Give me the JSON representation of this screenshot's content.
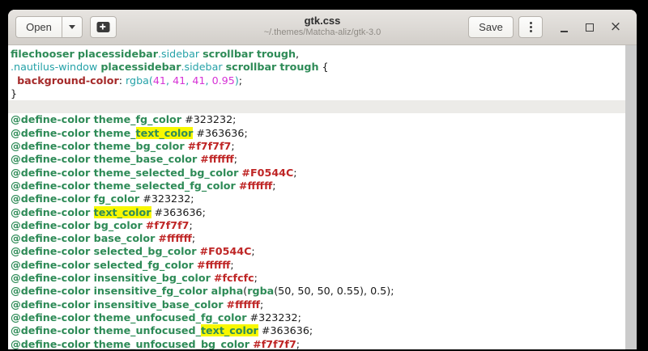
{
  "window": {
    "title": "gtk.css",
    "subtitle": "~/.themes/Matcha-aliz/gtk-3.0"
  },
  "header": {
    "open_label": "Open",
    "save_label": "Save",
    "close_glyph": "×"
  },
  "colors": {
    "app_bg": "#000000",
    "headerbar_bg": "#dedad5",
    "headerbar_border": "#c0bcb7",
    "button_bg": "#fbfbfa",
    "button_border": "#b7b3ad",
    "button_text": "#3a3a3a",
    "title_text": "#2d2d2d",
    "subtitle_text": "#8e8a84",
    "editor_bg": "#ffffff",
    "cursor_line_bg": "#ecebe8",
    "scrollbar_bg": "#cbcbcb",
    "search_highlight_bg": "#f8f800",
    "syntax": {
      "sel": "#2e8b57",
      "cls": "#25a2a8",
      "prop": "#a52a2a",
      "fn": "#25a2a8",
      "num": "#d633d6",
      "val": "#bf2626",
      "plain": "#1a1a1a"
    }
  },
  "editor": {
    "lines": [
      {
        "tokens": [
          [
            "sel",
            "filechooser"
          ],
          [
            "plain",
            " "
          ],
          [
            "sel",
            "placessidebar"
          ],
          [
            "cls",
            ".sidebar"
          ],
          [
            "plain",
            " "
          ],
          [
            "sel",
            "scrollbar"
          ],
          [
            "plain",
            " "
          ],
          [
            "sel",
            "trough"
          ],
          [
            "plain",
            ","
          ]
        ]
      },
      {
        "tokens": [
          [
            "cls",
            ".nautilus-window"
          ],
          [
            "plain",
            " "
          ],
          [
            "sel",
            "placessidebar"
          ],
          [
            "cls",
            ".sidebar"
          ],
          [
            "plain",
            " "
          ],
          [
            "sel",
            "scrollbar"
          ],
          [
            "plain",
            " "
          ],
          [
            "sel",
            "trough"
          ],
          [
            "plain",
            " {"
          ]
        ]
      },
      {
        "tokens": [
          [
            "plain",
            "  "
          ],
          [
            "prop",
            "background-color"
          ],
          [
            "plain",
            ": "
          ],
          [
            "fn",
            "rgba("
          ],
          [
            "num",
            "41"
          ],
          [
            "fn",
            ", "
          ],
          [
            "num",
            "41"
          ],
          [
            "fn",
            ", "
          ],
          [
            "num",
            "41"
          ],
          [
            "fn",
            ", "
          ],
          [
            "num",
            "0.95"
          ],
          [
            "fn",
            ")"
          ],
          [
            "plain",
            ";"
          ]
        ]
      },
      {
        "tokens": [
          [
            "plain",
            "}"
          ]
        ]
      },
      {
        "cursor": true,
        "tokens": []
      },
      {
        "tokens": [
          [
            "sel",
            "@define-color theme_fg_color"
          ],
          [
            "plain",
            " #323232;"
          ]
        ]
      },
      {
        "tokens": [
          [
            "sel",
            "@define-color theme_"
          ],
          [
            "sel",
            "text_color",
            1
          ],
          [
            "plain",
            " #363636;"
          ]
        ]
      },
      {
        "tokens": [
          [
            "sel",
            "@define-color theme_bg_color"
          ],
          [
            "plain",
            " "
          ],
          [
            "val",
            "#f7f7f7"
          ],
          [
            "plain",
            ";"
          ]
        ]
      },
      {
        "tokens": [
          [
            "sel",
            "@define-color theme_base_color"
          ],
          [
            "plain",
            " "
          ],
          [
            "val",
            "#ffffff"
          ],
          [
            "plain",
            ";"
          ]
        ]
      },
      {
        "tokens": [
          [
            "sel",
            "@define-color theme_selected_bg_color"
          ],
          [
            "plain",
            " "
          ],
          [
            "val",
            "#F0544C"
          ],
          [
            "plain",
            ";"
          ]
        ]
      },
      {
        "tokens": [
          [
            "sel",
            "@define-color theme_selected_fg_color"
          ],
          [
            "plain",
            " "
          ],
          [
            "val",
            "#ffffff"
          ],
          [
            "plain",
            ";"
          ]
        ]
      },
      {
        "tokens": [
          [
            "sel",
            "@define-color fg_color"
          ],
          [
            "plain",
            " #323232;"
          ]
        ]
      },
      {
        "tokens": [
          [
            "sel",
            "@define-color "
          ],
          [
            "sel",
            "text_color",
            1
          ],
          [
            "plain",
            " #363636;"
          ]
        ]
      },
      {
        "tokens": [
          [
            "sel",
            "@define-color bg_color"
          ],
          [
            "plain",
            " "
          ],
          [
            "val",
            "#f7f7f7"
          ],
          [
            "plain",
            ";"
          ]
        ]
      },
      {
        "tokens": [
          [
            "sel",
            "@define-color base_color"
          ],
          [
            "plain",
            " "
          ],
          [
            "val",
            "#ffffff"
          ],
          [
            "plain",
            ";"
          ]
        ]
      },
      {
        "tokens": [
          [
            "sel",
            "@define-color selected_bg_color"
          ],
          [
            "plain",
            " "
          ],
          [
            "val",
            "#F0544C"
          ],
          [
            "plain",
            ";"
          ]
        ]
      },
      {
        "tokens": [
          [
            "sel",
            "@define-color selected_fg_color"
          ],
          [
            "plain",
            " "
          ],
          [
            "val",
            "#ffffff"
          ],
          [
            "plain",
            ";"
          ]
        ]
      },
      {
        "tokens": [
          [
            "sel",
            "@define-color insensitive_bg_color"
          ],
          [
            "plain",
            " "
          ],
          [
            "val",
            "#fcfcfc"
          ],
          [
            "plain",
            ";"
          ]
        ]
      },
      {
        "tokens": [
          [
            "sel",
            "@define-color insensitive_fg_color alpha"
          ],
          [
            "plain",
            "("
          ],
          [
            "sel",
            "rgba"
          ],
          [
            "plain",
            "(50, 50, 50, 0.55), 0.5);"
          ]
        ]
      },
      {
        "tokens": [
          [
            "sel",
            "@define-color insensitive_base_color"
          ],
          [
            "plain",
            " "
          ],
          [
            "val",
            "#ffffff"
          ],
          [
            "plain",
            ";"
          ]
        ]
      },
      {
        "tokens": [
          [
            "sel",
            "@define-color theme_unfocused_fg_color"
          ],
          [
            "plain",
            " #323232;"
          ]
        ]
      },
      {
        "tokens": [
          [
            "sel",
            "@define-color theme_unfocused_"
          ],
          [
            "sel",
            "text_color",
            1
          ],
          [
            "plain",
            " #363636;"
          ]
        ]
      },
      {
        "tokens": [
          [
            "sel",
            "@define-color theme_unfocused_bg_color"
          ],
          [
            "plain",
            " "
          ],
          [
            "val",
            "#f7f7f7"
          ],
          [
            "plain",
            ";"
          ]
        ]
      }
    ]
  }
}
